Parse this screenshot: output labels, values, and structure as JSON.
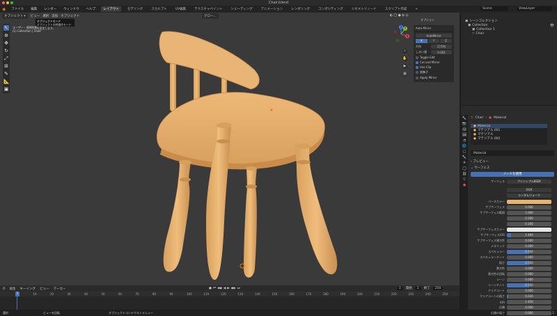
{
  "window": {
    "title": "Chair.blend",
    "traffic_lights": [
      "#ff5f57",
      "#febc2e",
      "#28c840"
    ]
  },
  "menu": {
    "items": [
      "ファイル",
      "編集",
      "レンダー",
      "ウィンドウ",
      "ヘルプ"
    ],
    "workspaces": [
      "レイアウト",
      "モデリング",
      "スカルプト",
      "UV編集",
      "テクスチャペイント",
      "シェーディング",
      "アニメーション",
      "レンダリング",
      "コンポジティング",
      "ジオメトリノード",
      "スクリプト作成"
    ],
    "active_workspace": 0,
    "add_tab": "+",
    "scene": "Scene",
    "view_layer": "ViewLayer"
  },
  "viewport": {
    "mode": "オブジェクト",
    "menus": [
      "ビュー",
      "選択",
      "追加",
      "オブジェクト"
    ],
    "transform": "グロー...",
    "tooltip_title": "オブジェクトモード",
    "tooltip_body": "オブジェクトの時操作モードを設定します。",
    "user_persp": "ユーザー・透視投影",
    "collection_info": "(1) Collection | Chair",
    "options_label": "オプション",
    "gizmo_axes": {
      "x": "X",
      "y": "Y",
      "z": "Z"
    },
    "accent_color": "#4772b3",
    "chair_color": "#e8b36e",
    "background_color": "#3a3a3a"
  },
  "redo_panel": {
    "title": "Auto Mirror",
    "button": "AutoMirror",
    "axes": [
      "X",
      "Y",
      "Z"
    ],
    "active_axis": 0,
    "orientation_label": "方向",
    "orientation_value": "正方向",
    "threshold_label": "しきい値",
    "threshold_value": "0.001",
    "checkboxes": [
      {
        "label": "Toggle Edit",
        "checked": false
      },
      {
        "label": "Cut and Mirror",
        "checked": true
      },
      {
        "label": "Use Clip",
        "checked": true
      },
      {
        "label": "Apply Mirror",
        "checked": false
      }
    ],
    "mirror_label": "修飾子"
  },
  "timeline": {
    "menus": [
      "再生",
      "キーイング",
      "ビュー",
      "マーカー"
    ],
    "current_frame": "1",
    "start_label": "開始",
    "start": "1",
    "end_label": "終了",
    "end": "250",
    "ticks": [
      "0",
      "10",
      "20",
      "30",
      "40",
      "50",
      "60",
      "70",
      "80",
      "90",
      "100",
      "110",
      "120",
      "130",
      "140",
      "150",
      "160",
      "170",
      "180",
      "190",
      "200",
      "210",
      "220",
      "230",
      "240",
      "250"
    ]
  },
  "status": {
    "left": "選択",
    "middle": "ビューを回転",
    "right": "オブジェクトコンテクストメニュー",
    "version": "3.5.1"
  },
  "outliner": {
    "items": [
      {
        "label": "シーンコレクション",
        "indent": 0
      },
      {
        "label": "Collection",
        "indent": 1
      },
      {
        "label": "Collection 1",
        "indent": 2
      },
      {
        "label": "Chair",
        "indent": 2
      }
    ]
  },
  "properties": {
    "breadcrumb_object": "Chair",
    "breadcrumb_material": "Material",
    "materials": [
      "Material",
      "マテリアル.001",
      "マテリアル",
      "マテリアル.002"
    ],
    "selected_material": 0,
    "material_name": "Material",
    "preview_label": "プレビュー",
    "surface_label": "サーフェス",
    "use_nodes": "ノードを使用",
    "surface_shader_label": "サーフェス",
    "surface_shader": "プリンシプルBSDF",
    "distribution": "GGX",
    "subsurface_method": "ランダムウォーク",
    "base_color_label": "ベースカラー",
    "base_color": "#e8b36e",
    "rows": [
      {
        "label": "サブサーフェス",
        "value": "0.000",
        "fill": 0
      },
      {
        "label": "サブサーフェス範囲",
        "value": "1.000",
        "fill": 0
      },
      {
        "label": "",
        "value": "0.200",
        "fill": 0
      },
      {
        "label": "",
        "value": "0.100",
        "fill": 0
      },
      {
        "label": "サブサーフェスカラー",
        "value": "",
        "fill": 0,
        "color": "#e6e6e6"
      },
      {
        "label": "サブサーフェスIOR",
        "value": "1.400",
        "fill": 0.1
      },
      {
        "label": "サブサーフェス異方性",
        "value": "0.000",
        "fill": 0
      },
      {
        "label": "メタリック",
        "value": "0.000",
        "fill": 0
      },
      {
        "label": "スペキュラー",
        "value": "0.500",
        "fill": 0.5
      },
      {
        "label": "スペキュラーチント",
        "value": "0.000",
        "fill": 0
      },
      {
        "label": "粗さ",
        "value": "0.500",
        "fill": 0.5
      },
      {
        "label": "異方性",
        "value": "0.000",
        "fill": 0
      },
      {
        "label": "異方性の回転",
        "value": "0.000",
        "fill": 0
      },
      {
        "label": "シーン",
        "value": "0.000",
        "fill": 0
      },
      {
        "label": "シーンチント",
        "value": "0.500",
        "fill": 0.5
      },
      {
        "label": "クリアコート",
        "value": "0.000",
        "fill": 0
      },
      {
        "label": "クリアコートの粗さ",
        "value": "0.030",
        "fill": 0.03
      },
      {
        "label": "IOR",
        "value": "1.450",
        "fill": 0
      },
      {
        "label": "伝播",
        "value": "0.000",
        "fill": 0
      },
      {
        "label": "伝播の粗さ",
        "value": "0.000",
        "fill": 0
      }
    ]
  }
}
